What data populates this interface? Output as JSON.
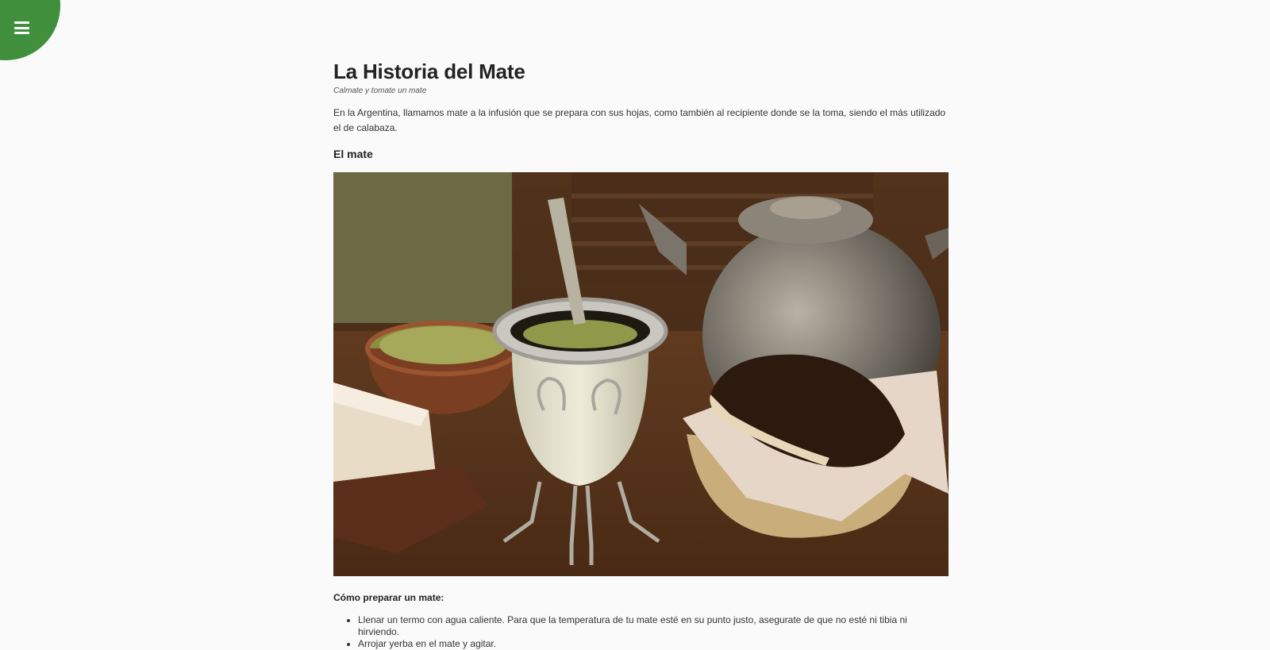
{
  "menu": {
    "icon": "hamburger-menu-icon",
    "accent_color": "#3f8f3c"
  },
  "article": {
    "title": "La Historia del Mate",
    "subtitle": "Calmate y tomate un mate",
    "intro": "En la Argentina, llamamos mate a la infusión que se prepara con sus hojas, como también al recipiente donde se la toma, siendo el más utilizado el de calabaza.",
    "section_heading": "El mate",
    "image": {
      "subject": "mate-with-bombilla-photo"
    },
    "howto_heading": "Cómo preparar un mate:",
    "steps": [
      "Llenar un termo con agua caliente. Para que la temperatura de tu mate esté en su punto justo, asegurate de que no esté ni tibia ni hirviendo.",
      "Arrojar yerba en el mate y agitar."
    ]
  }
}
